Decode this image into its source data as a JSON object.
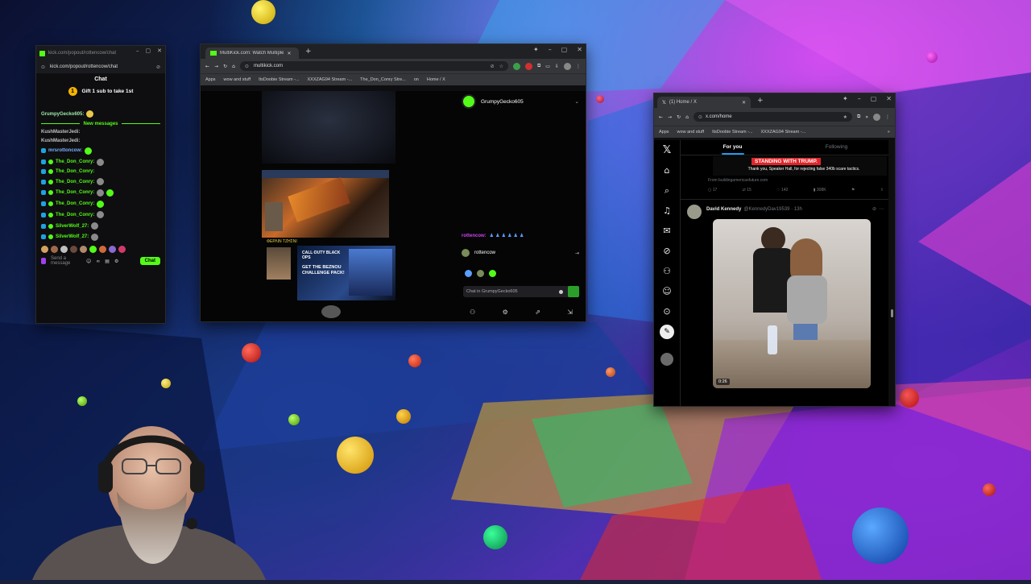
{
  "kick_chat_window": {
    "url": "kick.com/popout/rottencow/chat",
    "tab_title": "kick.com/popout/rottencow/chat",
    "panel_title": "Chat",
    "gift_text": "Gift 1 sub to take 1st",
    "gift_coin": "1",
    "new_messages_label": "New messages",
    "messages": [
      {
        "user": "GrumpyGecko605:"
      },
      {
        "user": "KushMasterJedi:"
      },
      {
        "user": "KushMasterJedi:"
      },
      {
        "user": "mrsrottoncow:"
      },
      {
        "user": "The_Don_Conry:"
      },
      {
        "user": "The_Don_Conry:"
      },
      {
        "user": "The_Don_Conry:"
      },
      {
        "user": "The_Don_Conry:"
      },
      {
        "user": "The_Don_Conry:"
      },
      {
        "user": "The_Don_Conry:"
      },
      {
        "user": "SilverWolf_27:"
      },
      {
        "user": "SilverWolf_27:"
      }
    ],
    "input_placeholder": "Send a message",
    "chat_button": "Chat"
  },
  "multikick_window": {
    "tab_title": "MultiKick.com: Watch Multiple",
    "url": "multikick.com",
    "bookmarks": [
      "Apps",
      "wow and stuff",
      "ItsDoobie Stream -...",
      "XXXZAG94 Stream -...",
      "The_Don_Conry Stre...",
      "on",
      "Home / X"
    ],
    "streamer": "GrumpyGecko605",
    "chat_user_line": "rottencow:",
    "chat_user2": "rottencow",
    "chat_input_placeholder": "Chat in GrumpyGecko605",
    "overlay_text": "CALL·DUTY BLACK OPS",
    "promo_title": "GET THE BEZNOU CHALLENGE PACK!"
  },
  "x_window": {
    "tab_title": "(1) Home / X",
    "url": "x.com/home",
    "bookmarks": [
      "Apps",
      "wow and stuff",
      "ItsDoobie Stream -...",
      "XXXZAG94 Stream -..."
    ],
    "tabs": [
      "For you",
      "Following"
    ],
    "banner_text": "STANDING WITH TRUMP.",
    "banner_sub": "Thank you, Speaker Hall, for rejecting false 340b scare tactics.",
    "banner_source": "From buildingamericasfuture.com",
    "stats": {
      "replies": "17",
      "reposts": "15",
      "likes": "142",
      "views": "308K"
    },
    "post_author": "David Kennedy",
    "post_handle": "@KennedyDav19539 · 13h",
    "video_time": "0:26"
  },
  "colors": {
    "kick_green": "#53fc18",
    "x_blue": "#1d9bf0",
    "banner_red": "#e0252a"
  }
}
